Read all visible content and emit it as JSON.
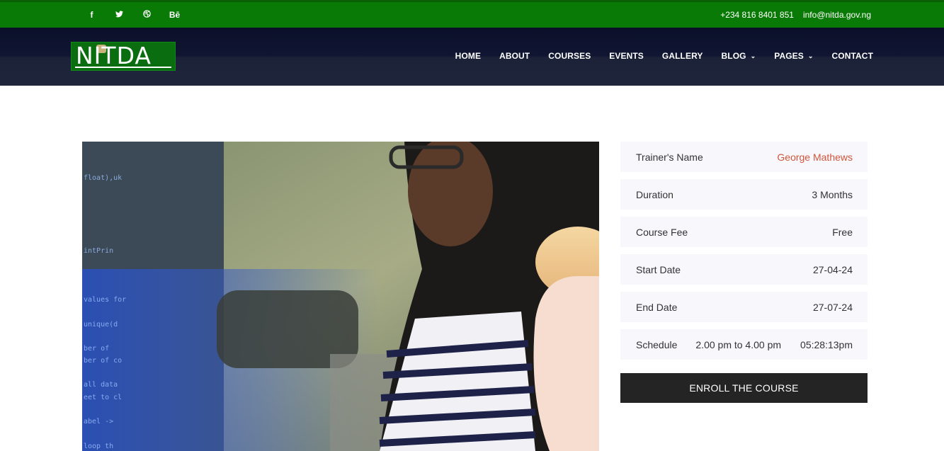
{
  "topbar": {
    "social": [
      {
        "icon": "facebook-icon",
        "glyph": "f"
      },
      {
        "icon": "twitter-icon",
        "glyph": "🐦"
      },
      {
        "icon": "dribbble-icon",
        "glyph": "⊛"
      },
      {
        "icon": "behance-icon",
        "glyph": "Bē"
      }
    ],
    "phone": "+234 816 8401 851",
    "email": "info@nitda.gov.ng",
    "color": "#0a7a06"
  },
  "header": {
    "logo_text": "NITDA",
    "nav": [
      {
        "label": "HOME",
        "dropdown": false
      },
      {
        "label": "ABOUT",
        "dropdown": false
      },
      {
        "label": "COURSES",
        "dropdown": false
      },
      {
        "label": "EVENTS",
        "dropdown": false
      },
      {
        "label": "GALLERY",
        "dropdown": false
      },
      {
        "label": "BLOG",
        "dropdown": true
      },
      {
        "label": "PAGES",
        "dropdown": true
      },
      {
        "label": "CONTACT",
        "dropdown": false
      }
    ]
  },
  "course": {
    "image_icon": "course-photo",
    "details": {
      "trainer_label": "Trainer's Name",
      "trainer_value": "George Mathews",
      "duration_label": "Duration",
      "duration_value": "3 Months",
      "fee_label": "Course Fee",
      "fee_value": "Free",
      "start_label": "Start Date",
      "start_value": "27-04-24",
      "end_label": "End Date",
      "end_value": "27-07-24",
      "schedule_label": "Schedule",
      "schedule_time": "2.00 pm to 4.00 pm",
      "schedule_clock": "05:28:13pm"
    },
    "enroll_label": "ENROLL THE COURSE",
    "accent_color": "#d2553a"
  }
}
